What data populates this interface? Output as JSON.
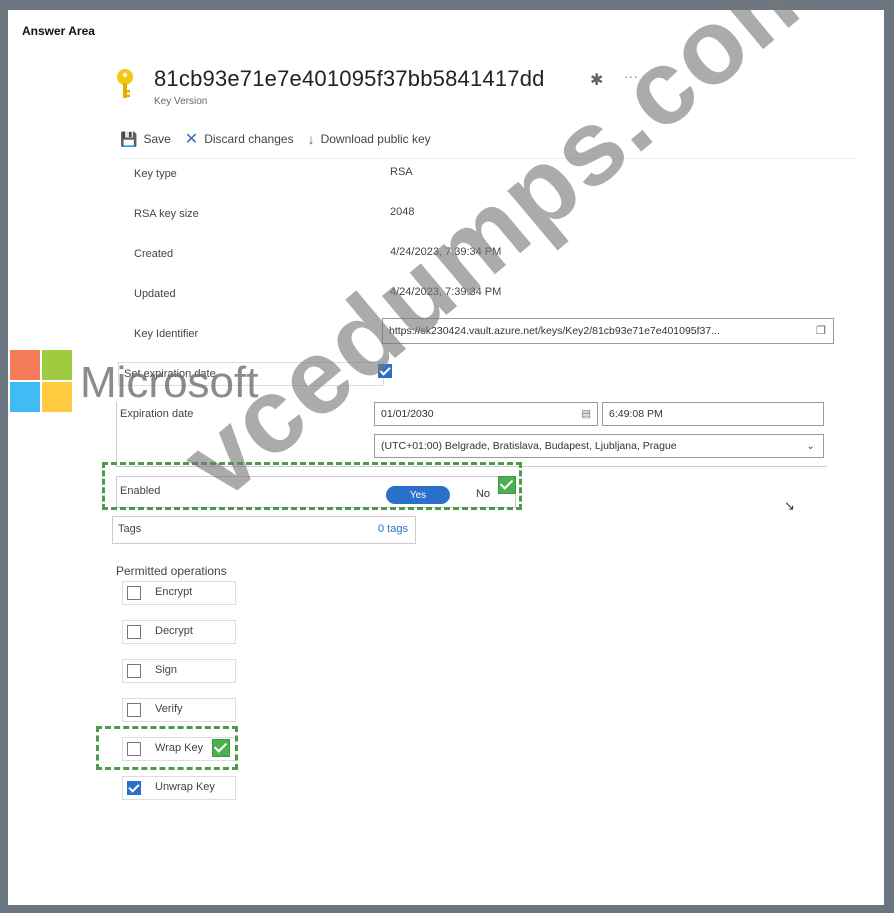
{
  "answer_area_label": "Answer Area",
  "key": {
    "id": "81cb93e71e7e401095f37bb5841417dd",
    "subtitle": "Key Version",
    "icon": "key-icon"
  },
  "toolbar": {
    "save": "Save",
    "discard": "Discard changes",
    "download": "Download public key"
  },
  "properties": {
    "key_type_label": "Key type",
    "key_type_value": "RSA",
    "key_size_label": "RSA key size",
    "key_size_value": "2048",
    "created_label": "Created",
    "created_value": "4/24/2023, 7:39:34 PM",
    "updated_label": "Updated",
    "updated_value": "4/24/2023, 7:39:34 PM",
    "identifier_label": "Key Identifier",
    "identifier_value": "https://sk230424.vault.azure.net/keys/Key2/81cb93e71e7e401095f37..."
  },
  "expiration": {
    "set_label": "Set expiration date",
    "set_checked": true,
    "date_label": "Expiration date",
    "date_value": "01/01/2030",
    "time_value": "6:49:08 PM",
    "timezone_value": "(UTC+01:00) Belgrade, Bratislava, Budapest, Ljubljana, Prague"
  },
  "enabled": {
    "label": "Enabled",
    "yes": "Yes",
    "no": "No"
  },
  "tags": {
    "label": "Tags",
    "value": "0 tags"
  },
  "permitted": {
    "heading": "Permitted operations",
    "items": [
      {
        "label": "Encrypt",
        "checked": false
      },
      {
        "label": "Decrypt",
        "checked": false
      },
      {
        "label": "Sign",
        "checked": false
      },
      {
        "label": "Verify",
        "checked": false
      },
      {
        "label": "Wrap Key",
        "checked": false
      },
      {
        "label": "Unwrap Key",
        "checked": true
      }
    ]
  },
  "watermark": {
    "text": "vcedumps.com",
    "brand": "Microsoft"
  },
  "colors": {
    "accent": "#2a6fc9",
    "answer_mark": "#4caf50",
    "frame": "#6b7580"
  }
}
